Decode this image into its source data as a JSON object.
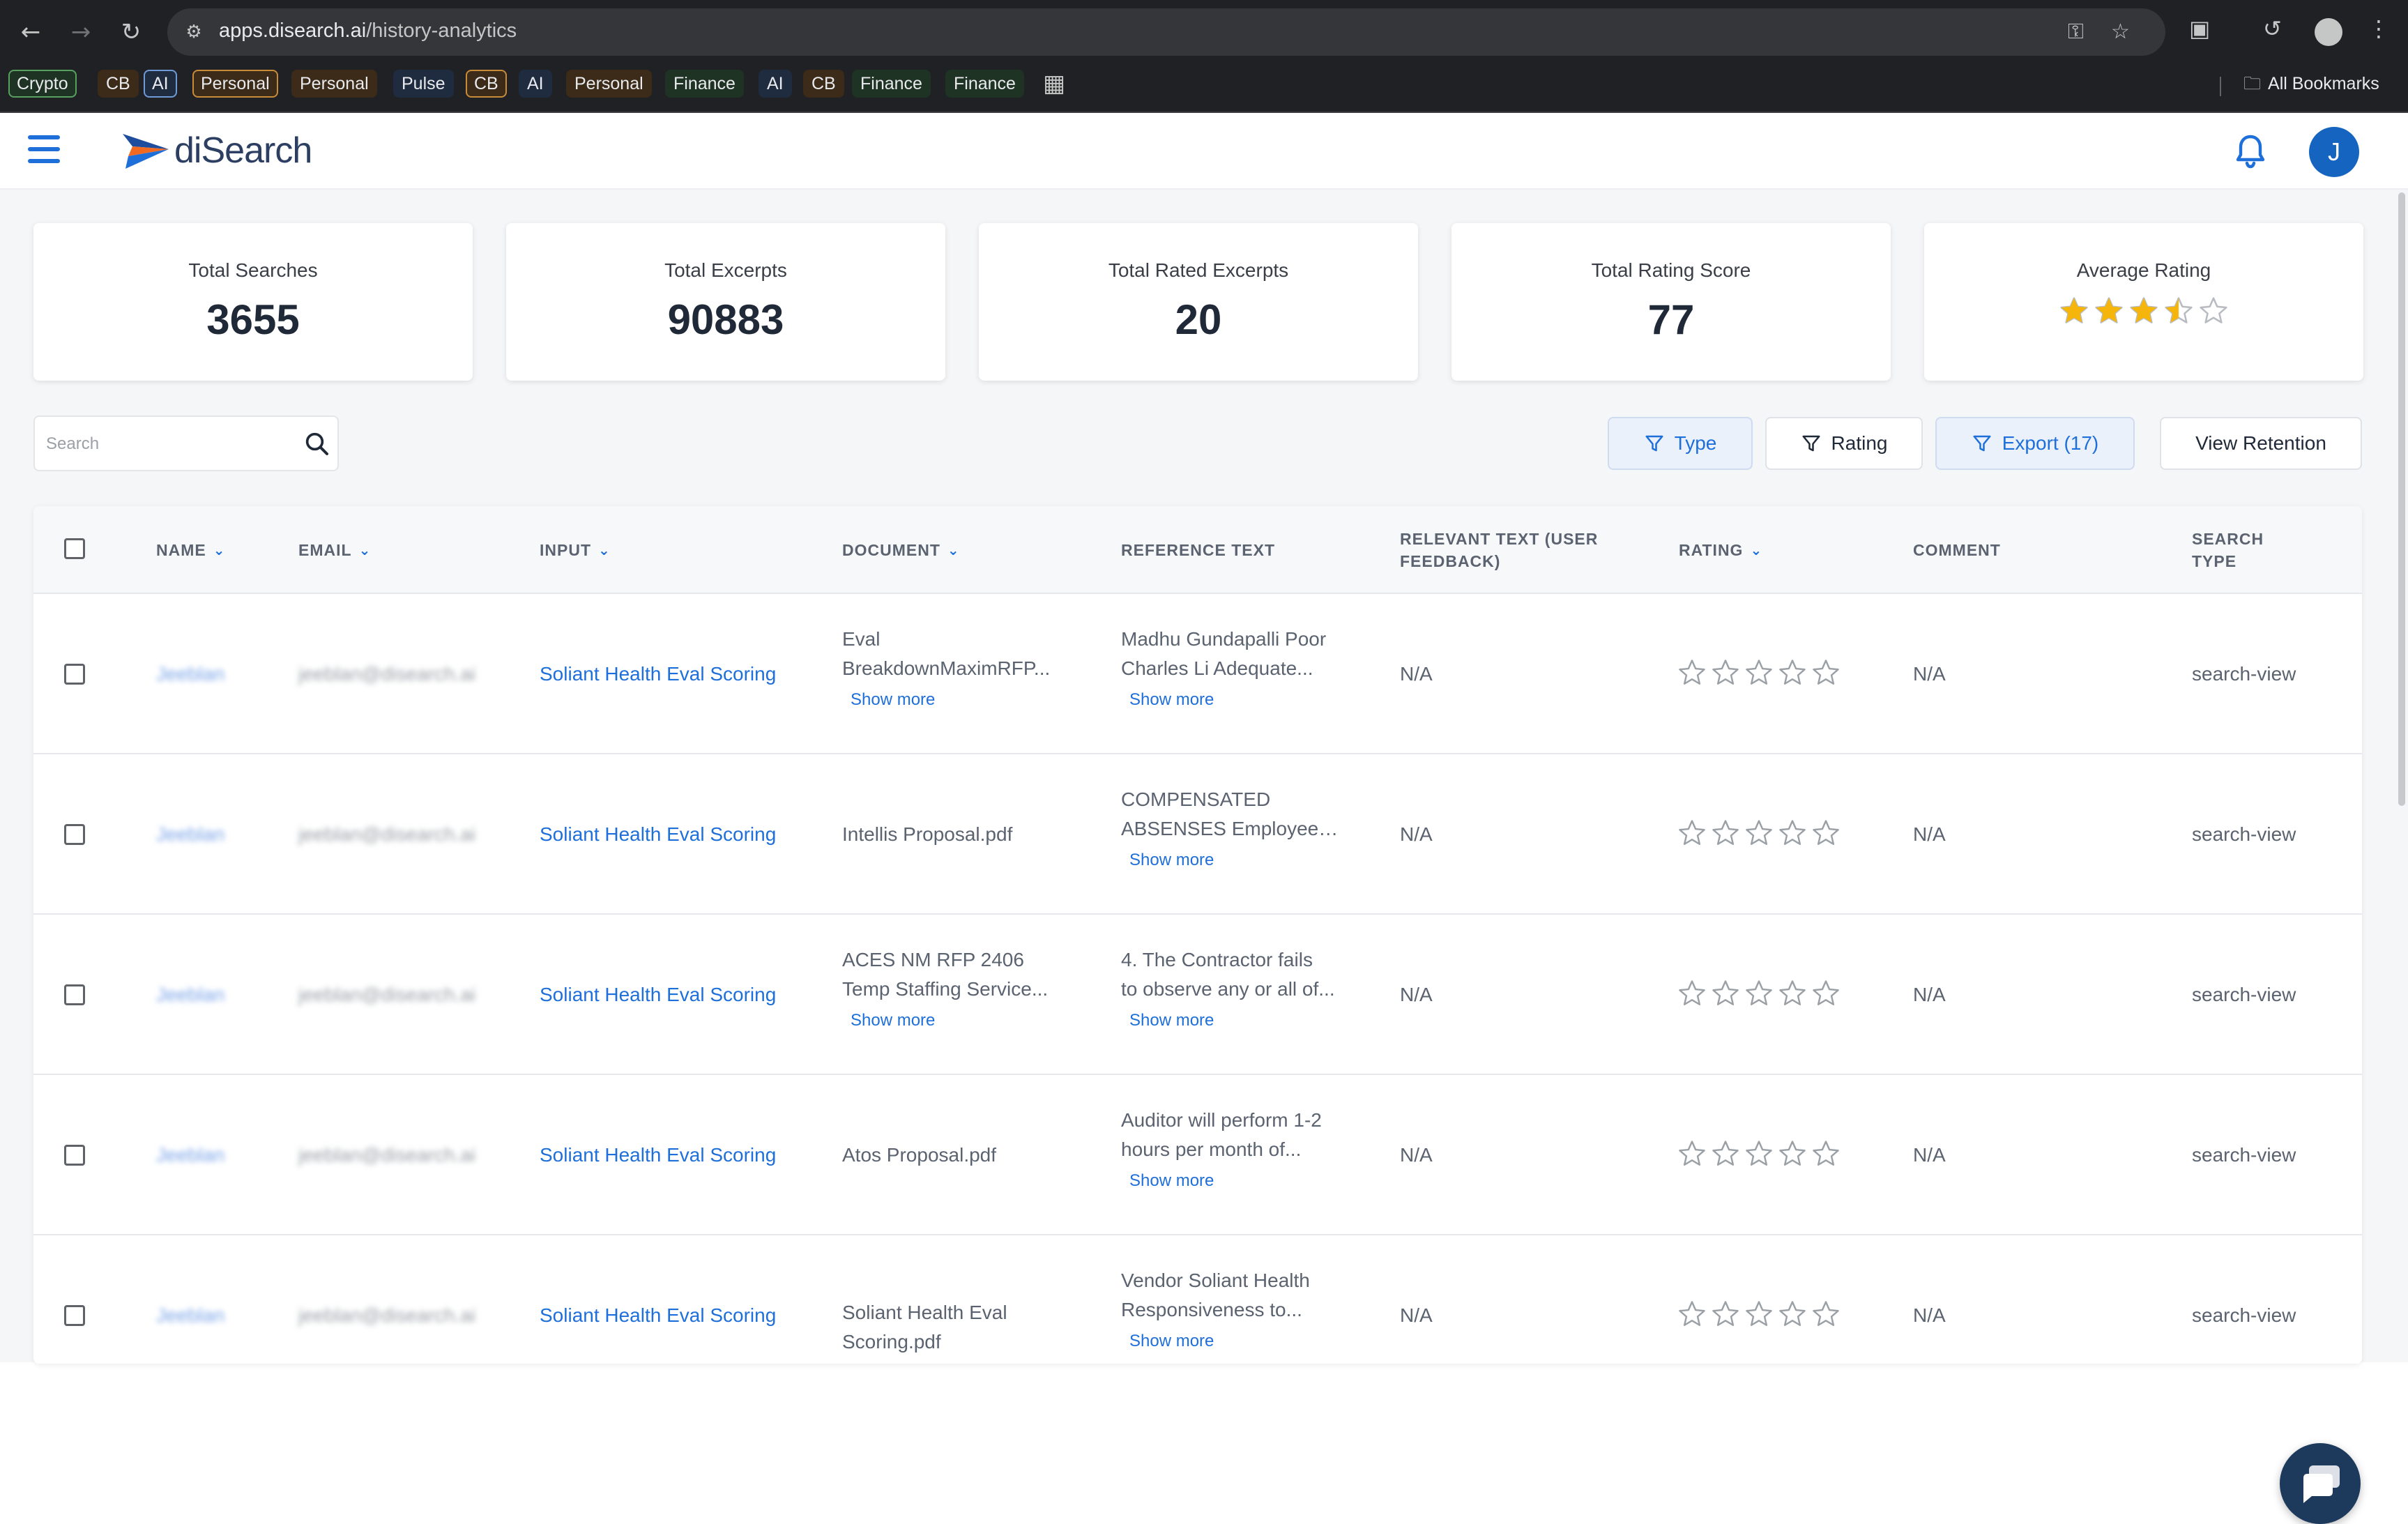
{
  "browser": {
    "url_host": "apps.disearch.ai",
    "url_path": "/history-analytics",
    "bookmarks": [
      {
        "label": "Crypto",
        "style": "b-green"
      },
      {
        "label": "CB",
        "style": "tint-orange"
      },
      {
        "label": "AI",
        "style": "b-blue"
      },
      {
        "label": "Personal",
        "style": "b-orange"
      },
      {
        "label": "Personal",
        "style": "tint-orange"
      },
      {
        "label": "Pulse",
        "style": "tint-blue"
      },
      {
        "label": "CB",
        "style": "b-orange"
      },
      {
        "label": "AI",
        "style": "tint-blue"
      },
      {
        "label": "Personal",
        "style": "tint-orange"
      },
      {
        "label": "Finance",
        "style": "tint-green"
      },
      {
        "label": "AI",
        "style": "tint-blue"
      },
      {
        "label": "CB",
        "style": "tint-orange"
      },
      {
        "label": "Finance",
        "style": "tint-green"
      },
      {
        "label": "Finance",
        "style": "tint-green"
      }
    ],
    "all_bookmarks": "All Bookmarks"
  },
  "header": {
    "logo_text": "diSearch",
    "avatar_initial": "J"
  },
  "stats": {
    "total_searches": {
      "label": "Total Searches",
      "value": "3655"
    },
    "total_excerpts": {
      "label": "Total Excerpts",
      "value": "90883"
    },
    "total_rated": {
      "label": "Total Rated Excerpts",
      "value": "20"
    },
    "total_score": {
      "label": "Total Rating Score",
      "value": "77"
    },
    "average_rating": {
      "label": "Average Rating",
      "value": 3.5,
      "max": 5
    }
  },
  "toolbar": {
    "search_placeholder": "Search",
    "type_label": "Type",
    "rating_label": "Rating",
    "export_label": "Export (17)",
    "retention_label": "View Retention"
  },
  "table": {
    "headers": {
      "name": "NAME",
      "email": "EMAIL",
      "input": "INPUT",
      "document": "DOCUMENT",
      "reference": "REFERENCE TEXT",
      "relevant_1": "RELEVANT TEXT (USER",
      "relevant_2": "FEEDBACK)",
      "rating": "RATING",
      "comment": "COMMENT",
      "search_type_1": "SEARCH",
      "search_type_2": "TYPE"
    },
    "show_more": "Show more",
    "rows": [
      {
        "name": "Jeeblan",
        "email": "jeeblan@disearch.ai",
        "input": "Soliant Health Eval Scoring",
        "doc1": "Eval",
        "doc2": "BreakdownMaximRFP...",
        "doc_more": true,
        "ref1": "Madhu Gundapalli Poor",
        "ref2": "Charles Li Adequate...",
        "relevant": "N/A",
        "rating": 0,
        "comment": "N/A",
        "type": "search-view"
      },
      {
        "name": "Jeeblan",
        "email": "jeeblan@disearch.ai",
        "input": "Soliant Health Eval Scoring",
        "doc1": "Intellis Proposal.pdf",
        "doc2": "",
        "doc_more": false,
        "ref1": "COMPENSATED",
        "ref2": "ABSENSES Employees...",
        "relevant": "N/A",
        "rating": 0,
        "comment": "N/A",
        "type": "search-view"
      },
      {
        "name": "Jeeblan",
        "email": "jeeblan@disearch.ai",
        "input": "Soliant Health Eval Scoring",
        "doc1": "ACES NM RFP 2406",
        "doc2": "Temp Staffing Service...",
        "doc_more": true,
        "ref1": "4. The Contractor fails",
        "ref2": "to observe any or all of...",
        "relevant": "N/A",
        "rating": 0,
        "comment": "N/A",
        "type": "search-view"
      },
      {
        "name": "Jeeblan",
        "email": "jeeblan@disearch.ai",
        "input": "Soliant Health Eval Scoring",
        "doc1": "Atos Proposal.pdf",
        "doc2": "",
        "doc_more": false,
        "ref1": "Auditor will perform 1-2",
        "ref2": "hours per month of...",
        "relevant": "N/A",
        "rating": 0,
        "comment": "N/A",
        "type": "search-view"
      },
      {
        "name": "Jeeblan",
        "email": "jeeblan@disearch.ai",
        "input": "Soliant Health Eval Scoring",
        "doc1": "Soliant Health Eval",
        "doc2": "Scoring.pdf",
        "doc_more": false,
        "ref1": "Vendor Soliant Health",
        "ref2": "Responsiveness to...",
        "relevant": "N/A",
        "rating": 0,
        "comment": "N/A",
        "type": "search-view"
      }
    ]
  },
  "colors": {
    "accent": "#1e6fd9",
    "star_filled": "#f5b50a",
    "star_empty": "#b8bcc2"
  }
}
